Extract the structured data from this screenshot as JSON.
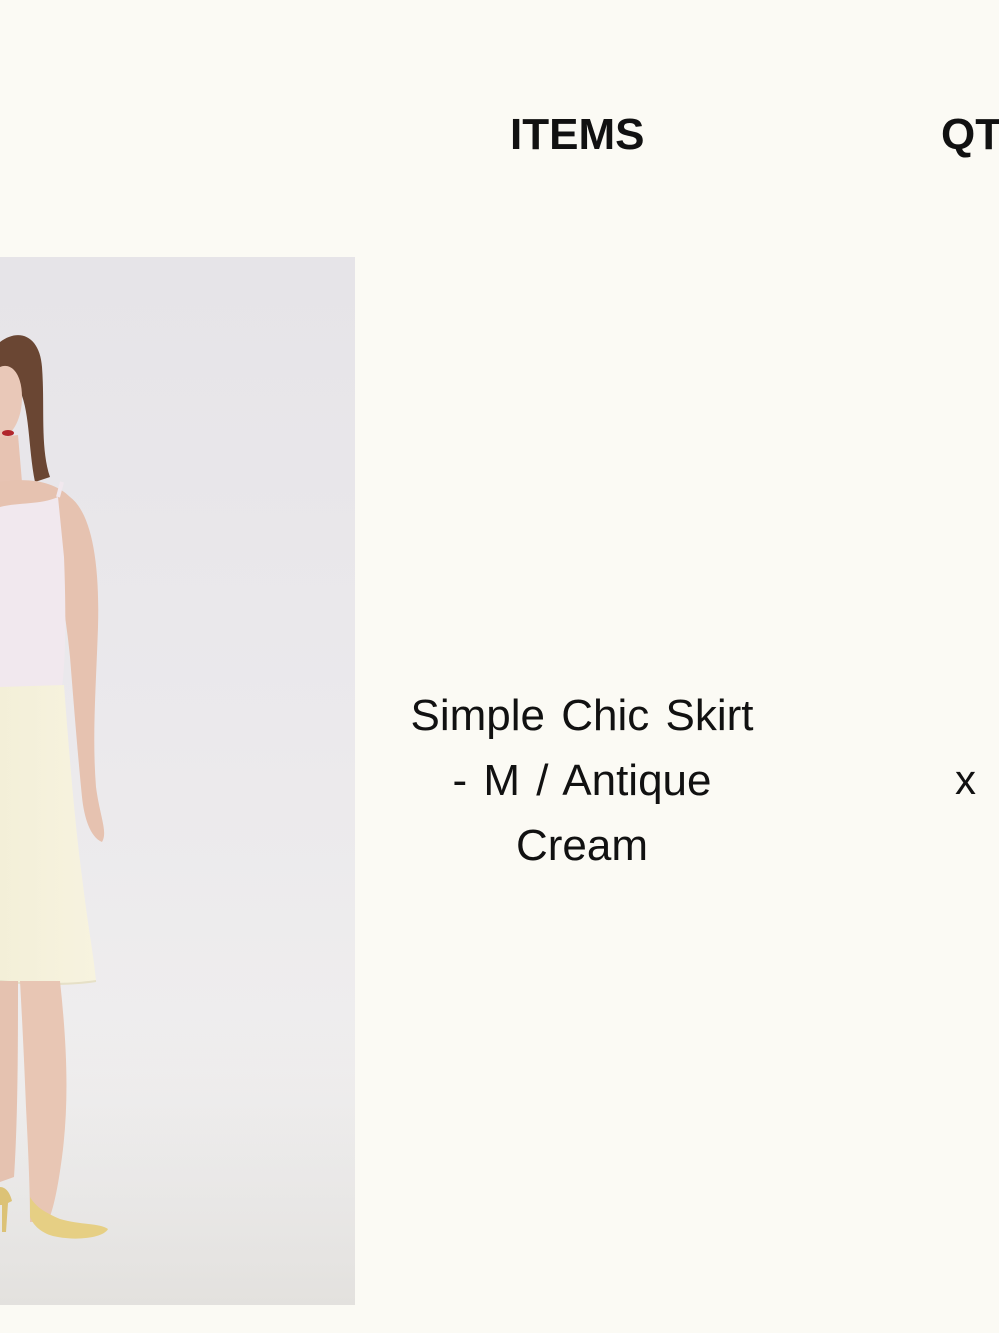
{
  "cart_table": {
    "headers": {
      "items": "ITEMS",
      "qty": "QT"
    },
    "rows": [
      {
        "item_name": "Simple Chic Skirt - M / Antique Cream",
        "qty_prefix": "x",
        "image_description_icon": "product-photo"
      }
    ]
  }
}
